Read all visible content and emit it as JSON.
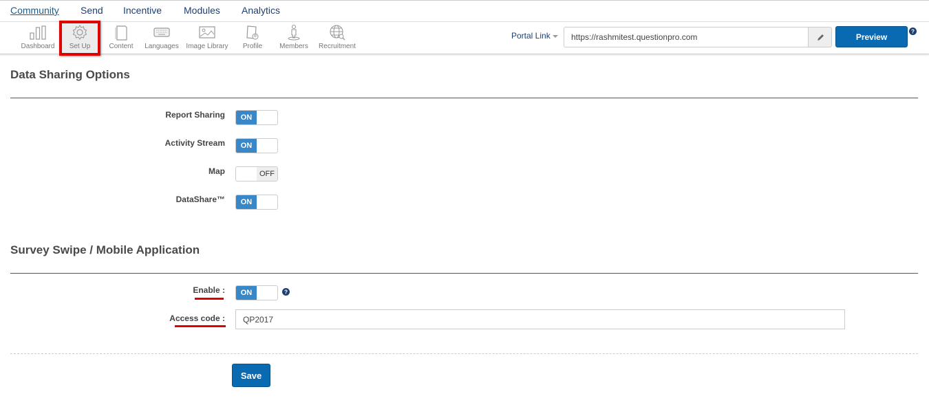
{
  "topnav": {
    "tabs": [
      {
        "label": "Community",
        "active": true
      },
      {
        "label": "Send"
      },
      {
        "label": "Incentive"
      },
      {
        "label": "Modules"
      },
      {
        "label": "Analytics"
      }
    ]
  },
  "toolbar": {
    "items": [
      {
        "label": "Dashboard",
        "icon": "bar-chart-icon"
      },
      {
        "label": "Set Up",
        "icon": "gear-icon",
        "active": true
      },
      {
        "label": "Content",
        "icon": "document-icon"
      },
      {
        "label": "Languages",
        "icon": "keyboard-icon"
      },
      {
        "label": "Image Library",
        "icon": "image-icon"
      },
      {
        "label": "Profile",
        "icon": "profile-icon"
      },
      {
        "label": "Members",
        "icon": "member-icon"
      },
      {
        "label": "Recruitment",
        "icon": "globe-search-icon"
      }
    ],
    "portal_link_label": "Portal Link",
    "portal_url": "https://rashmitest.questionpro.com",
    "edit_icon": "pencil-icon",
    "preview_label": "Preview",
    "help_icon": "question-circle-icon"
  },
  "data_sharing": {
    "title": "Data Sharing Options",
    "options": [
      {
        "label": "Report Sharing",
        "state": "ON"
      },
      {
        "label": "Activity Stream",
        "state": "ON"
      },
      {
        "label": "Map",
        "state": "OFF"
      },
      {
        "label": "DataShare™",
        "state": "ON"
      }
    ]
  },
  "survey_swipe": {
    "title": "Survey Swipe / Mobile Application",
    "enable_label": "Enable :",
    "enable_state": "ON",
    "access_code_label": "Access code :",
    "access_code_value": "QP2017"
  },
  "actions": {
    "save_label": "Save"
  },
  "colors": {
    "accent": "#0a6ab1",
    "toggle_on": "#3a87c8",
    "annotation_red": "#e00000",
    "nav_text": "#1d3f73"
  }
}
